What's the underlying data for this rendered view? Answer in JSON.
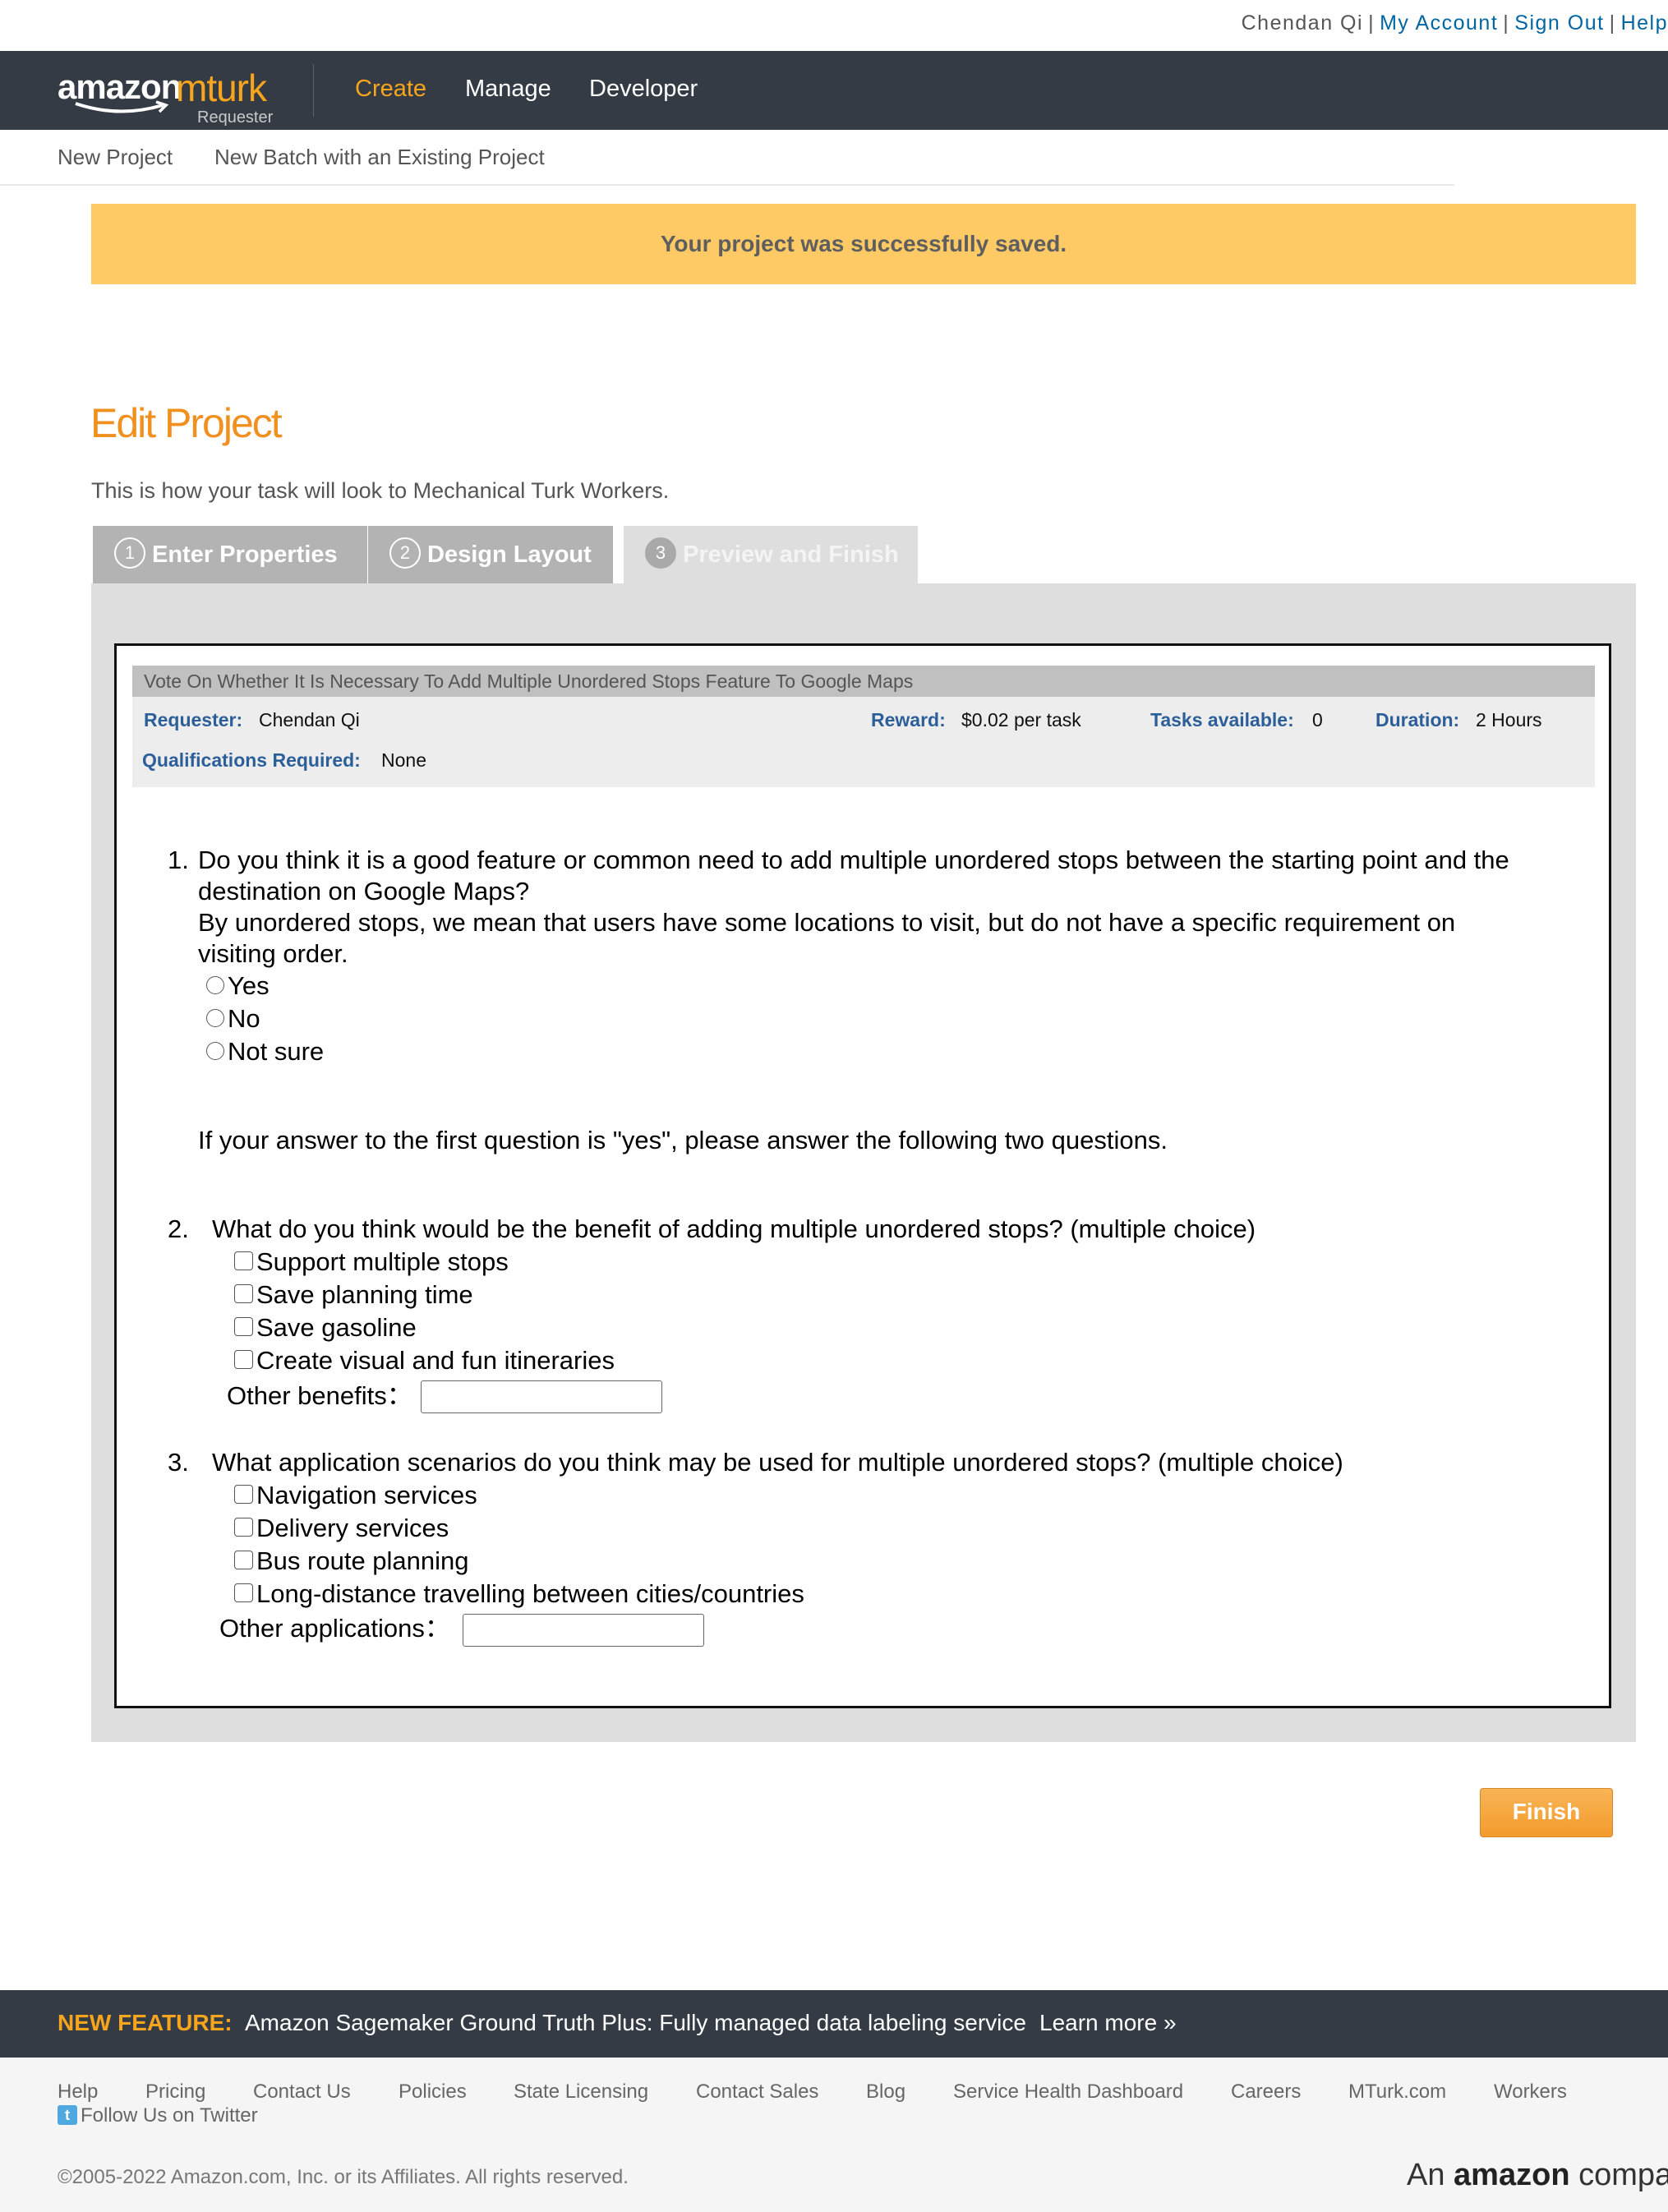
{
  "utility": {
    "user_name": "Chendan Qi",
    "my_account": "My Account",
    "sign_out": "Sign Out",
    "help": "Help"
  },
  "header": {
    "logo_amazon": "amazon",
    "logo_mturk": "mturk",
    "logo_requester": "Requester",
    "nav": [
      "Create",
      "Manage",
      "Developer"
    ],
    "active_color": "#f7a51c"
  },
  "subnav": {
    "items": [
      "New Project",
      "New Batch with an Existing Project"
    ]
  },
  "banner": {
    "message": "Your project was successfully saved."
  },
  "page": {
    "title": "Edit Project",
    "description": "This is how your task will look to Mechanical Turk Workers."
  },
  "tabs": [
    {
      "num": "1",
      "label": "Enter Properties"
    },
    {
      "num": "2",
      "label": "Design Layout"
    },
    {
      "num": "3",
      "label": "Preview and Finish"
    }
  ],
  "hit": {
    "title": "Vote On Whether It Is Necessary To Add Multiple Unordered Stops Feature To Google Maps",
    "requester_label": "Requester:",
    "requester_value": "Chendan Qi",
    "reward_label": "Reward:",
    "reward_value": "$0.02 per task",
    "tasks_label": "Tasks available:",
    "tasks_value": "0",
    "duration_label": "Duration:",
    "duration_value": "2 Hours",
    "quals_label": "Qualifications Required:",
    "quals_value": "None"
  },
  "survey": {
    "q1_num": "1.",
    "q1_line1": "Do you think it is a good feature or common need to add multiple unordered stops between the starting point and the",
    "q1_line2": "destination on Google Maps?",
    "q1_line3": "By unordered stops, we mean that users have some locations to visit, but do not have a specific requirement on",
    "q1_line4": "visiting order.",
    "q1_options": [
      "Yes",
      "No",
      "Not sure"
    ],
    "conditional_note": "If your answer to the first question is \"yes\", please answer the following two questions.",
    "q2_num": "2.",
    "q2_text": "What do you think would be the benefit of adding multiple unordered stops? (multiple choice)",
    "q2_options": [
      "Support multiple stops",
      "Save planning time",
      "Save gasoline",
      "Create visual and fun itineraries"
    ],
    "q2_other_label": "Other benefits：",
    "q3_num": "3.",
    "q3_text": "What application scenarios do you think may be used for multiple unordered stops? (multiple choice)",
    "q3_options": [
      "Navigation services",
      "Delivery services",
      "Bus route planning",
      "Long-distance travelling between cities/countries"
    ],
    "q3_other_label": "Other applications："
  },
  "finish_button": "Finish",
  "footer": {
    "feature_label": "NEW FEATURE:",
    "feature_text": "Amazon Sagemaker Ground Truth Plus: Fully managed data labeling service",
    "feature_link": "Learn more »",
    "links": [
      "Help",
      "Pricing",
      "Contact Us",
      "Policies",
      "State Licensing",
      "Contact Sales",
      "Blog",
      "Service Health Dashboard",
      "Careers",
      "MTurk.com",
      "Workers"
    ],
    "twitter": "Follow Us on Twitter",
    "copyright": "©2005-2022 Amazon.com, Inc. or its Affiliates. All rights reserved.",
    "company_prefix": "An",
    "company_brand": "amazon",
    "company_suffix": "company"
  }
}
